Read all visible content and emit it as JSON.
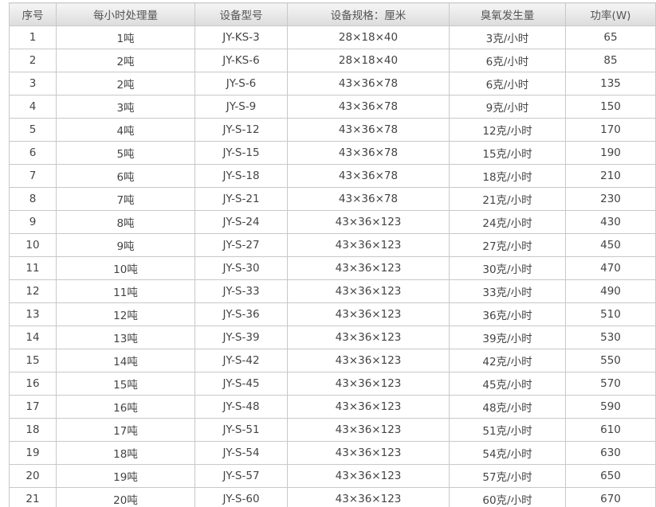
{
  "table": {
    "headers": [
      "序号",
      "每小时处理量",
      "设备型号",
      "设备规格：厘米",
      "臭氧发生量",
      "功率(W)"
    ],
    "rows": [
      [
        "1",
        "1吨",
        "JY-KS-3",
        "28×18×40",
        "3克/小时",
        "65"
      ],
      [
        "2",
        "2吨",
        "JY-KS-6",
        "28×18×40",
        "6克/小时",
        "85"
      ],
      [
        "3",
        "2吨",
        "JY-S-6",
        "43×36×78",
        "6克/小时",
        "135"
      ],
      [
        "4",
        "3吨",
        "JY-S-9",
        "43×36×78",
        "9克/小时",
        "150"
      ],
      [
        "5",
        "4吨",
        "JY-S-12",
        "43×36×78",
        "12克/小时",
        "170"
      ],
      [
        "6",
        "5吨",
        "JY-S-15",
        "43×36×78",
        "15克/小时",
        "190"
      ],
      [
        "7",
        "6吨",
        "JY-S-18",
        "43×36×78",
        "18克/小时",
        "210"
      ],
      [
        "8",
        "7吨",
        "JY-S-21",
        "43×36×78",
        "21克/小时",
        "230"
      ],
      [
        "9",
        "8吨",
        "JY-S-24",
        "43×36×123",
        "24克/小时",
        "430"
      ],
      [
        "10",
        "9吨",
        "JY-S-27",
        "43×36×123",
        "27克/小时",
        "450"
      ],
      [
        "11",
        "10吨",
        "JY-S-30",
        "43×36×123",
        "30克/小时",
        "470"
      ],
      [
        "12",
        "11吨",
        "JY-S-33",
        "43×36×123",
        "33克/小时",
        "490"
      ],
      [
        "13",
        "12吨",
        "JY-S-36",
        "43×36×123",
        "36克/小时",
        "510"
      ],
      [
        "14",
        "13吨",
        "JY-S-39",
        "43×36×123",
        "39克/小时",
        "530"
      ],
      [
        "15",
        "14吨",
        "JY-S-42",
        "43×36×123",
        "42克/小时",
        "550"
      ],
      [
        "16",
        "15吨",
        "JY-S-45",
        "43×36×123",
        "45克/小时",
        "570"
      ],
      [
        "17",
        "16吨",
        "JY-S-48",
        "43×36×123",
        "48克/小时",
        "590"
      ],
      [
        "18",
        "17吨",
        "JY-S-51",
        "43×36×123",
        "51克/小时",
        "610"
      ],
      [
        "19",
        "18吨",
        "JY-S-54",
        "43×36×123",
        "54克/小时",
        "630"
      ],
      [
        "20",
        "19吨",
        "JY-S-57",
        "43×36×123",
        "57克/小时",
        "650"
      ],
      [
        "21",
        "20吨",
        "JY-S-60",
        "43×36×123",
        "60克/小时",
        "670"
      ]
    ]
  },
  "colors": {
    "border": "#c8c8c8",
    "header_bg": "#e6e6e6",
    "text": "#444444"
  }
}
